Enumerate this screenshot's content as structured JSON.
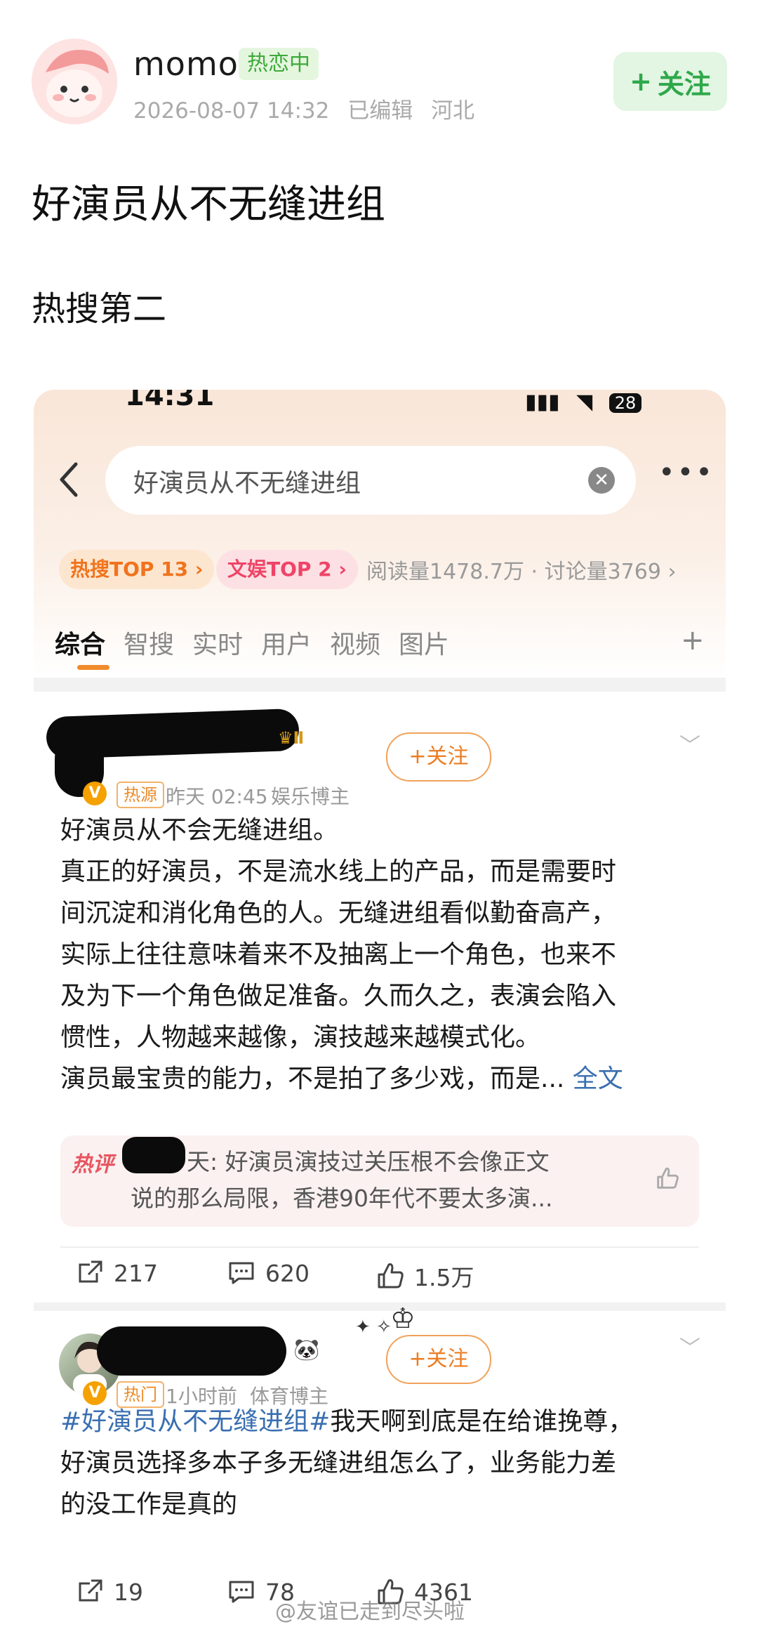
{
  "post": {
    "author": "momo",
    "author_badge": "热恋中",
    "date": "2026-08-07 14:32",
    "edited": "已编辑",
    "location": "河北",
    "follow_label": "关注",
    "title": "好演员从不无缝进组",
    "subtitle": "热搜第二"
  },
  "screenshot": {
    "status_time": "14:31",
    "battery": "28",
    "search_query": "好演员从不无缝进组",
    "tag_hot": "热搜TOP 13 ›",
    "tag_ent": "文娱TOP 2 ›",
    "read_stats": "阅读量1478.7万 · 讨论量3769 ›",
    "tabs": [
      "综合",
      "智搜",
      "实时",
      "用户",
      "视频",
      "图片",
      "+"
    ],
    "feed": [
      {
        "tag": "热源",
        "time": "昨天 02:45",
        "category": "娱乐博主",
        "follow_label": "+关注",
        "text_lines": [
          "好演员从不会无缝进组。",
          "真正的好演员，不是流水线上的产品，而是需要时",
          "间沉淀和消化角色的人。无缝进组看似勤奋高产，",
          "实际上往往意味着来不及抽离上一个角色，也来不",
          "及为下一个角色做足准备。久而久之，表演会陷入",
          "惯性，人物越来越像，演技越来越模式化。",
          "演员最宝贵的能力，不是拍了多少戏，而是..."
        ],
        "full_text_link": "全文",
        "hot_comment_label": "热评",
        "hot_comment_suffix": "天:",
        "hot_comment_text_1": "好演员演技过关压根不会像正文",
        "hot_comment_text_2": "说的那么局限，香港90年代不要太多演...",
        "reposts": "217",
        "comments": "620",
        "likes": "1.5万"
      },
      {
        "tag": "热门",
        "time": "1小时前",
        "category": "体育博主",
        "follow_label": "+关注",
        "hashtag": "#好演员从不无缝进组#",
        "text_after_hashtag": "我天啊到底是在给谁挽尊，",
        "text_lines": [
          "好演员选择多本子多无缝进组怎么了，业务能力差",
          "的没工作是真的"
        ],
        "reposts": "19",
        "comments": "78",
        "likes": "4361"
      }
    ]
  },
  "watermark": "@友谊已走到尽头啦"
}
